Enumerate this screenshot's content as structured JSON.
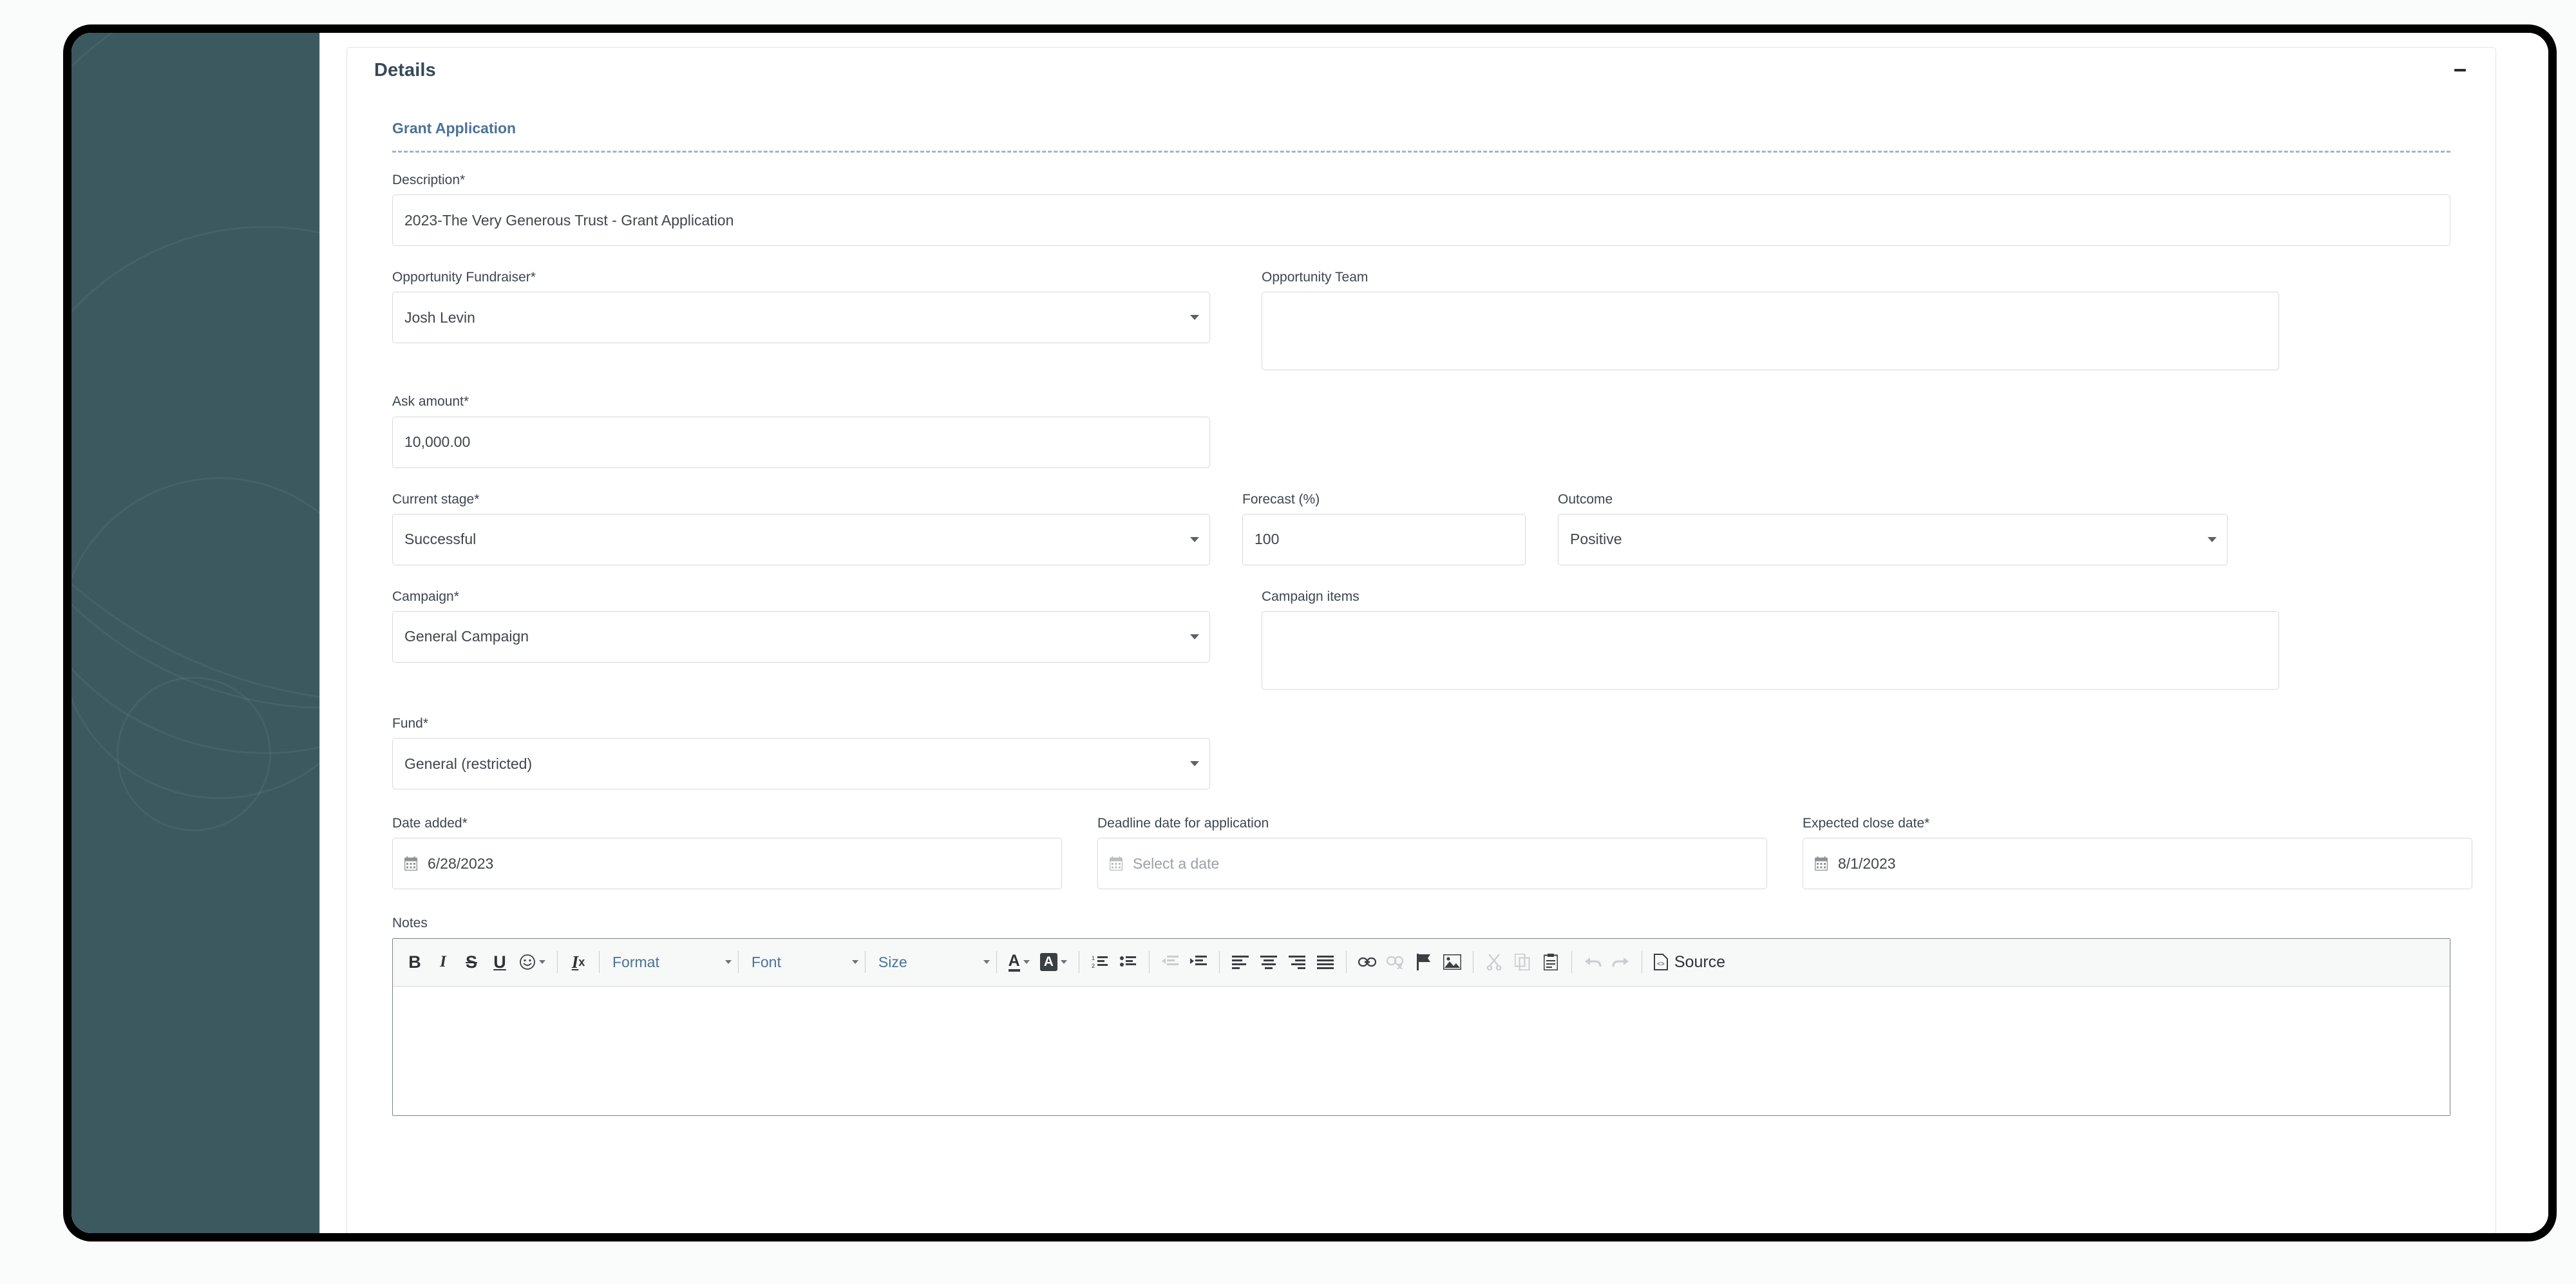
{
  "card": {
    "title": "Details",
    "collapse_icon": "minus-icon",
    "section_title": "Grant Application"
  },
  "fields": {
    "description": {
      "label": "Description*",
      "value": "2023-The Very Generous Trust - Grant Application"
    },
    "opportunity_fundraiser": {
      "label": "Opportunity Fundraiser*",
      "value": "Josh Levin"
    },
    "opportunity_team": {
      "label": "Opportunity Team",
      "value": ""
    },
    "ask_amount": {
      "label": "Ask amount*",
      "value": "10,000.00"
    },
    "current_stage": {
      "label": "Current stage*",
      "value": "Successful"
    },
    "forecast": {
      "label": "Forecast (%)",
      "value": "100"
    },
    "outcome": {
      "label": "Outcome",
      "value": "Positive"
    },
    "campaign": {
      "label": "Campaign*",
      "value": "General Campaign"
    },
    "campaign_items": {
      "label": "Campaign items",
      "value": ""
    },
    "fund": {
      "label": "Fund*",
      "value": "General (restricted)"
    },
    "date_added": {
      "label": "Date added*",
      "value": "6/28/2023",
      "icon": "calendar-icon"
    },
    "deadline_date": {
      "label": "Deadline date for application",
      "value": "",
      "placeholder": "Select a date",
      "icon": "calendar-icon"
    },
    "expected_close_date": {
      "label": "Expected close date*",
      "value": "8/1/2023",
      "icon": "calendar-icon"
    },
    "notes": {
      "label": "Notes",
      "value": ""
    }
  },
  "editor_toolbar": {
    "bold": "B",
    "italic": "I",
    "strikethrough": "S",
    "underline": "U",
    "emoji": "smiley-icon",
    "remove_format": "remove-format-icon",
    "format": "Format",
    "font": "Font",
    "size": "Size",
    "text_color": "A",
    "background_color": "A",
    "numbered_list": "numbered-list-icon",
    "bulleted_list": "bulleted-list-icon",
    "outdent": "outdent-icon",
    "indent": "indent-icon",
    "align_left": "align-left-icon",
    "align_center": "align-center-icon",
    "align_right": "align-right-icon",
    "justify": "justify-icon",
    "link": "link-icon",
    "unlink": "unlink-icon",
    "anchor": "flag-icon",
    "image": "image-icon",
    "cut": "scissors-icon",
    "copy": "copy-icon",
    "paste": "clipboard-icon",
    "undo": "undo-icon",
    "redo": "redo-icon",
    "source": "Source"
  },
  "colors": {
    "sidebar": "#3b595e",
    "card_title": "#34495a",
    "section_title": "#4b7397",
    "link": "#4b7397",
    "border": "#d6d9da",
    "toolbar_bg": "#f7f8f8"
  }
}
